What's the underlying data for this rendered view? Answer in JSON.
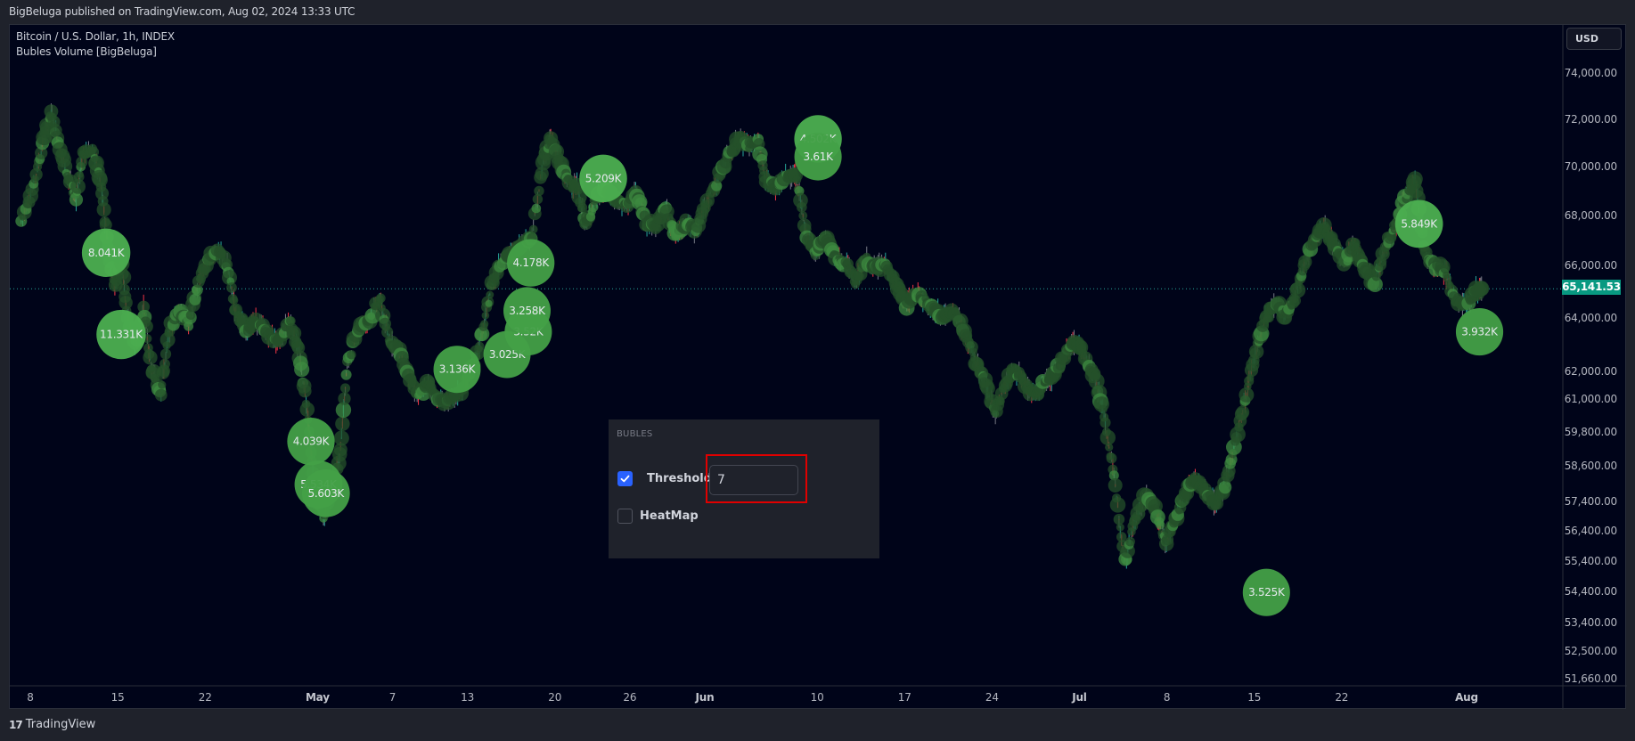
{
  "header": {
    "published_text": "BigBeluga published on TradingView.com, Aug 02, 2024 13:33 UTC"
  },
  "legend": {
    "symbol_line": "Bitcoin / U.S. Dollar, 1h, INDEX",
    "indicator_line": "Bubles Volume [BigBeluga]"
  },
  "price_axis": {
    "currency_button": "USD",
    "last_price": "65,141.53",
    "last_price_color": "#089981"
  },
  "settings_panel": {
    "section_title": "BUBLES",
    "threshold": {
      "label": "Threshold",
      "checked": true,
      "value": "7"
    },
    "heatmap": {
      "label": "HeatMap",
      "checked": false
    },
    "highlight_color": "#e00000"
  },
  "footer": {
    "logo_mark": "17",
    "logo_text": "TradingView"
  },
  "chart_data": {
    "type": "scatter",
    "title": "Bitcoin / U.S. Dollar, 1h, INDEX",
    "subtitle": "Bubles Volume [BigBeluga]",
    "xlabel": "",
    "ylabel": "",
    "y_scale": "log",
    "ylim": [
      51200,
      75200
    ],
    "y_ticks": [
      {
        "value": 74000,
        "label": "74,000.00"
      },
      {
        "value": 72000,
        "label": "72,000.00"
      },
      {
        "value": 70000,
        "label": "70,000.00"
      },
      {
        "value": 68000,
        "label": "68,000.00"
      },
      {
        "value": 66000,
        "label": "66,000.00"
      },
      {
        "value": 64000,
        "label": "64,000.00"
      },
      {
        "value": 62000,
        "label": "62,000.00"
      },
      {
        "value": 61000,
        "label": "61,000.00"
      },
      {
        "value": 59800,
        "label": "59,800.00"
      },
      {
        "value": 58600,
        "label": "58,600.00"
      },
      {
        "value": 57400,
        "label": "57,400.00"
      },
      {
        "value": 56400,
        "label": "56,400.00"
      },
      {
        "value": 55400,
        "label": "55,400.00"
      },
      {
        "value": 54400,
        "label": "54,400.00"
      },
      {
        "value": 53400,
        "label": "53,400.00"
      },
      {
        "value": 52500,
        "label": "52,500.00"
      },
      {
        "value": 51660,
        "label": "51,660.00"
      }
    ],
    "x_unit": "days since Apr 1, 2024",
    "xlim": [
      6.2,
      130
    ],
    "x_ticks": [
      {
        "day": 7,
        "label": "8",
        "month": false
      },
      {
        "day": 14,
        "label": "15",
        "month": false
      },
      {
        "day": 21,
        "label": "22",
        "month": false
      },
      {
        "day": 30,
        "label": "May",
        "month": true
      },
      {
        "day": 36,
        "label": "7",
        "month": false
      },
      {
        "day": 42,
        "label": "13",
        "month": false
      },
      {
        "day": 49,
        "label": "20",
        "month": false
      },
      {
        "day": 55,
        "label": "26",
        "month": false
      },
      {
        "day": 61,
        "label": "Jun",
        "month": true
      },
      {
        "day": 70,
        "label": "10",
        "month": false
      },
      {
        "day": 77,
        "label": "17",
        "month": false
      },
      {
        "day": 84,
        "label": "24",
        "month": false
      },
      {
        "day": 91,
        "label": "Jul",
        "month": true
      },
      {
        "day": 98,
        "label": "8",
        "month": false
      },
      {
        "day": 105,
        "label": "15",
        "month": false
      },
      {
        "day": 112,
        "label": "22",
        "month": false
      },
      {
        "day": 122,
        "label": "Aug",
        "month": true
      }
    ],
    "last_price": 65141.53,
    "price_path": [
      [
        6.2,
        67800
      ],
      [
        7.2,
        69300
      ],
      [
        8.0,
        71200
      ],
      [
        8.6,
        72300
      ],
      [
        9.2,
        71000
      ],
      [
        10.0,
        69500
      ],
      [
        10.6,
        68800
      ],
      [
        11.2,
        70700
      ],
      [
        12.0,
        70600
      ],
      [
        12.6,
        69200
      ],
      [
        13.2,
        66600
      ],
      [
        13.7,
        65300
      ],
      [
        14.2,
        66400
      ],
      [
        14.7,
        64000
      ],
      [
        15.3,
        63000
      ],
      [
        16.0,
        64400
      ],
      [
        16.6,
        62100
      ],
      [
        17.4,
        61300
      ],
      [
        18.0,
        63400
      ],
      [
        18.8,
        64400
      ],
      [
        19.6,
        63800
      ],
      [
        20.3,
        65200
      ],
      [
        21.1,
        66200
      ],
      [
        21.9,
        66700
      ],
      [
        22.7,
        66000
      ],
      [
        23.4,
        64200
      ],
      [
        24.2,
        63600
      ],
      [
        25.1,
        63900
      ],
      [
        26.0,
        63400
      ],
      [
        26.8,
        63100
      ],
      [
        27.7,
        64000
      ],
      [
        28.4,
        62800
      ],
      [
        29.1,
        60700
      ],
      [
        29.7,
        57600
      ],
      [
        30.4,
        56900
      ],
      [
        31.1,
        57800
      ],
      [
        31.7,
        58900
      ],
      [
        32.3,
        62300
      ],
      [
        33.2,
        63700
      ],
      [
        34.0,
        63900
      ],
      [
        34.9,
        64800
      ],
      [
        35.6,
        63200
      ],
      [
        36.4,
        62900
      ],
      [
        37.2,
        61900
      ],
      [
        38.0,
        61100
      ],
      [
        38.8,
        61600
      ],
      [
        39.6,
        61000
      ],
      [
        40.4,
        60900
      ],
      [
        41.4,
        61300
      ],
      [
        42.4,
        62200
      ],
      [
        43.2,
        63600
      ],
      [
        43.9,
        65400
      ],
      [
        44.6,
        66200
      ],
      [
        45.4,
        66500
      ],
      [
        46.3,
        66900
      ],
      [
        47.1,
        67200
      ],
      [
        48.0,
        70200
      ],
      [
        48.6,
        71300
      ],
      [
        49.2,
        70300
      ],
      [
        49.9,
        69500
      ],
      [
        50.7,
        69200
      ],
      [
        51.4,
        67600
      ],
      [
        52.2,
        68700
      ],
      [
        53.0,
        69100
      ],
      [
        53.8,
        68700
      ],
      [
        54.6,
        68400
      ],
      [
        55.4,
        69000
      ],
      [
        56.2,
        67800
      ],
      [
        57.0,
        67600
      ],
      [
        57.8,
        68300
      ],
      [
        58.6,
        67200
      ],
      [
        59.4,
        67800
      ],
      [
        60.2,
        67400
      ],
      [
        61.0,
        68500
      ],
      [
        62.0,
        69500
      ],
      [
        62.8,
        70500
      ],
      [
        63.6,
        71200
      ],
      [
        64.4,
        70900
      ],
      [
        65.2,
        71100
      ],
      [
        65.8,
        69500
      ],
      [
        66.6,
        69200
      ],
      [
        67.4,
        69600
      ],
      [
        68.2,
        69700
      ],
      [
        69.0,
        67400
      ],
      [
        69.8,
        66500
      ],
      [
        70.6,
        67200
      ],
      [
        71.4,
        66300
      ],
      [
        72.2,
        66200
      ],
      [
        73.0,
        65400
      ],
      [
        73.8,
        66300
      ],
      [
        74.6,
        65900
      ],
      [
        75.4,
        66100
      ],
      [
        76.2,
        65400
      ],
      [
        77.0,
        64500
      ],
      [
        77.8,
        65000
      ],
      [
        78.6,
        64700
      ],
      [
        79.4,
        64300
      ],
      [
        80.2,
        64100
      ],
      [
        81.0,
        64200
      ],
      [
        81.8,
        63400
      ],
      [
        82.6,
        62400
      ],
      [
        83.4,
        61600
      ],
      [
        84.2,
        60500
      ],
      [
        85.0,
        61600
      ],
      [
        85.8,
        62100
      ],
      [
        86.6,
        61500
      ],
      [
        87.4,
        61100
      ],
      [
        88.2,
        61700
      ],
      [
        89.0,
        61900
      ],
      [
        89.8,
        62700
      ],
      [
        90.6,
        63200
      ],
      [
        91.4,
        62500
      ],
      [
        92.2,
        61800
      ],
      [
        93.0,
        60200
      ],
      [
        93.8,
        57900
      ],
      [
        94.6,
        55400
      ],
      [
        95.4,
        56900
      ],
      [
        96.2,
        57600
      ],
      [
        97.0,
        57200
      ],
      [
        97.8,
        56000
      ],
      [
        98.6,
        56800
      ],
      [
        99.4,
        57700
      ],
      [
        100.2,
        58200
      ],
      [
        101.0,
        57800
      ],
      [
        101.8,
        57300
      ],
      [
        102.6,
        58000
      ],
      [
        103.4,
        59400
      ],
      [
        104.2,
        61000
      ],
      [
        105.0,
        62700
      ],
      [
        105.8,
        64000
      ],
      [
        106.6,
        64600
      ],
      [
        107.4,
        64100
      ],
      [
        108.2,
        64800
      ],
      [
        109.0,
        66300
      ],
      [
        109.8,
        67100
      ],
      [
        110.6,
        67600
      ],
      [
        111.4,
        66800
      ],
      [
        112.2,
        66200
      ],
      [
        113.0,
        66900
      ],
      [
        113.8,
        65800
      ],
      [
        114.6,
        65400
      ],
      [
        115.4,
        66800
      ],
      [
        116.2,
        67600
      ],
      [
        117.0,
        68700
      ],
      [
        117.8,
        69500
      ],
      [
        118.6,
        66500
      ],
      [
        119.4,
        66000
      ],
      [
        120.2,
        65800
      ],
      [
        121.0,
        64800
      ],
      [
        121.8,
        64400
      ],
      [
        122.6,
        65100
      ],
      [
        123.2,
        65141
      ]
    ],
    "bubbles": [
      {
        "label": "8.041K",
        "volume_k": 8.041,
        "day": 13.0,
        "price": 66550,
        "color": "#4caf50"
      },
      {
        "label": "11.331K",
        "volume_k": 11.331,
        "day": 14.2,
        "price": 63400,
        "color": "#4caf50"
      },
      {
        "label": "4.039K",
        "volume_k": 4.039,
        "day": 29.4,
        "price": 59500,
        "color": "#43a047"
      },
      {
        "label": "5.534K",
        "volume_k": 5.534,
        "day": 30.0,
        "price": 58000,
        "color": "#43a047"
      },
      {
        "label": "5.603K",
        "volume_k": 5.603,
        "day": 30.6,
        "price": 57700,
        "color": "#43a047"
      },
      {
        "label": "3.136K",
        "volume_k": 3.136,
        "day": 41.1,
        "price": 62100,
        "color": "#43a047"
      },
      {
        "label": "3.025K",
        "volume_k": 3.025,
        "day": 45.1,
        "price": 62650,
        "color": "#43a047"
      },
      {
        "label": "3.52K",
        "volume_k": 3.52,
        "day": 46.8,
        "price": 63500,
        "color": "#43a047"
      },
      {
        "label": "3.258K",
        "volume_k": 3.258,
        "day": 46.7,
        "price": 64300,
        "color": "#43a047"
      },
      {
        "label": "4.178K",
        "volume_k": 4.178,
        "day": 47.0,
        "price": 66150,
        "color": "#43a047"
      },
      {
        "label": "5.209K",
        "volume_k": 5.209,
        "day": 52.8,
        "price": 69550,
        "color": "#4caf50"
      },
      {
        "label": "4.502K",
        "volume_k": 4.502,
        "day": 70.0,
        "price": 71200,
        "color": "#4caf50"
      },
      {
        "label": "3.61K",
        "volume_k": 3.61,
        "day": 70.0,
        "price": 70450,
        "color": "#43a047"
      },
      {
        "label": "3.525K",
        "volume_k": 3.525,
        "day": 105.9,
        "price": 54400,
        "color": "#43a047"
      },
      {
        "label": "5.849K",
        "volume_k": 5.849,
        "day": 132.2,
        "price": 67700,
        "color": "#4caf50"
      },
      {
        "label": "3.932K",
        "volume_k": 3.932,
        "day": 137.9,
        "price": 63500,
        "color": "#43a047"
      }
    ]
  }
}
